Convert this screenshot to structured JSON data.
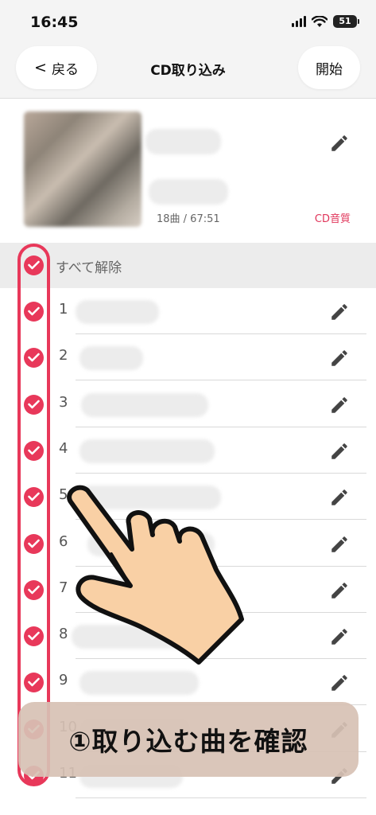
{
  "status_bar": {
    "time": "16:45",
    "battery": "51"
  },
  "nav": {
    "back_label": "戻る",
    "back_chevron": "<",
    "title": "CD取り込み",
    "start_label": "開始"
  },
  "album": {
    "meta": "18曲 / 67:51",
    "quality": "CD音質"
  },
  "select_all_label": "すべて解除",
  "tracks": [
    "1",
    "2",
    "3",
    "4",
    "5",
    "6",
    "7",
    "8",
    "9",
    "10",
    "11"
  ],
  "caption": "①取り込む曲を確認",
  "colors": {
    "accent": "#e8385a",
    "caption_bg": "#d7c1b4",
    "hand_fill": "#f9d0a5"
  },
  "icons": [
    "pencil-icon",
    "checkmark-icon",
    "hand-pointer-icon",
    "wifi-icon",
    "signal-icon",
    "battery-icon"
  ]
}
